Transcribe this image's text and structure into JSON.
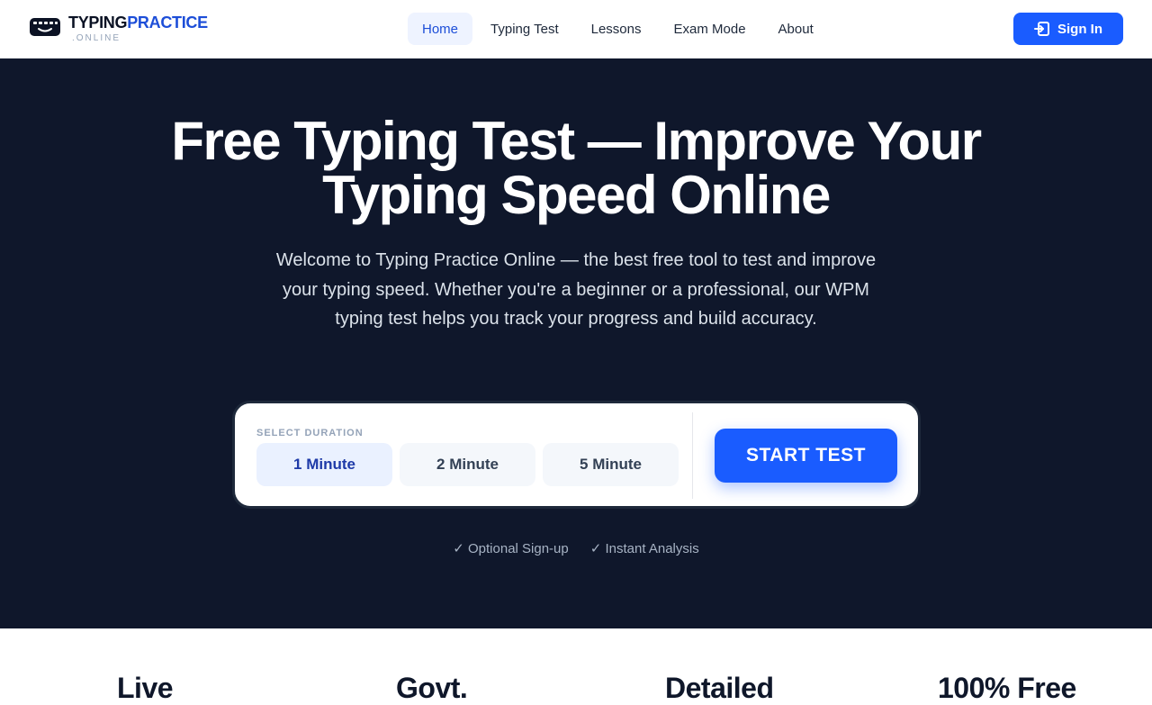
{
  "header": {
    "logo": {
      "title_part1": "TYPING",
      "title_part2": "PRACTICE",
      "subtitle": ".ONLINE"
    },
    "nav": [
      {
        "label": "Home",
        "active": true
      },
      {
        "label": "Typing Test",
        "active": false
      },
      {
        "label": "Lessons",
        "active": false
      },
      {
        "label": "Exam Mode",
        "active": false
      },
      {
        "label": "About",
        "active": false
      }
    ],
    "signin_label": "Sign In",
    "signin_icon": "sign-in-icon"
  },
  "hero": {
    "title": "Free Typing Test — Improve Your Typing Speed Online",
    "description": "Welcome to Typing Practice Online — the best free tool to test and improve your typing speed. Whether you're a beginner or a professional, our WPM typing test helps you track your progress and build accuracy.",
    "duration_label": "SELECT DURATION",
    "durations": [
      {
        "label": "1 Minute",
        "selected": true
      },
      {
        "label": "2 Minute",
        "selected": false
      },
      {
        "label": "5 Minute",
        "selected": false
      }
    ],
    "start_label": "START TEST",
    "perks": [
      "✓ Optional Sign-up",
      "✓ Instant Analysis"
    ]
  },
  "features": [
    "Live",
    "Govt.",
    "Detailed",
    "100% Free"
  ],
  "colors": {
    "accent": "#1a5cff",
    "hero_bg": "#0f172b",
    "active_nav_bg": "#eef3ff"
  }
}
